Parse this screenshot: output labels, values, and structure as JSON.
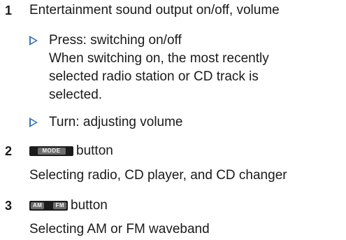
{
  "items": [
    {
      "number": "1",
      "title": "Entertainment sound output on/off, volume",
      "bullets": [
        {
          "lines": [
            "Press: switching on/off",
            "When switching on, the most recently",
            "selected radio station or CD track is",
            "selected."
          ]
        },
        {
          "lines": [
            "Turn: adjusting volume"
          ]
        }
      ]
    },
    {
      "number": "2",
      "button_image_text": "MODE",
      "title_suffix": "button",
      "description": "Selecting radio, CD player, and CD changer"
    },
    {
      "number": "3",
      "button_image_text_left": "AM",
      "button_image_text_right": "FM",
      "title_suffix": "button",
      "description": "Selecting AM or FM waveband"
    }
  ],
  "colors": {
    "bullet_arrow": "#3a72b8",
    "button_image": "#1c1c1c"
  }
}
